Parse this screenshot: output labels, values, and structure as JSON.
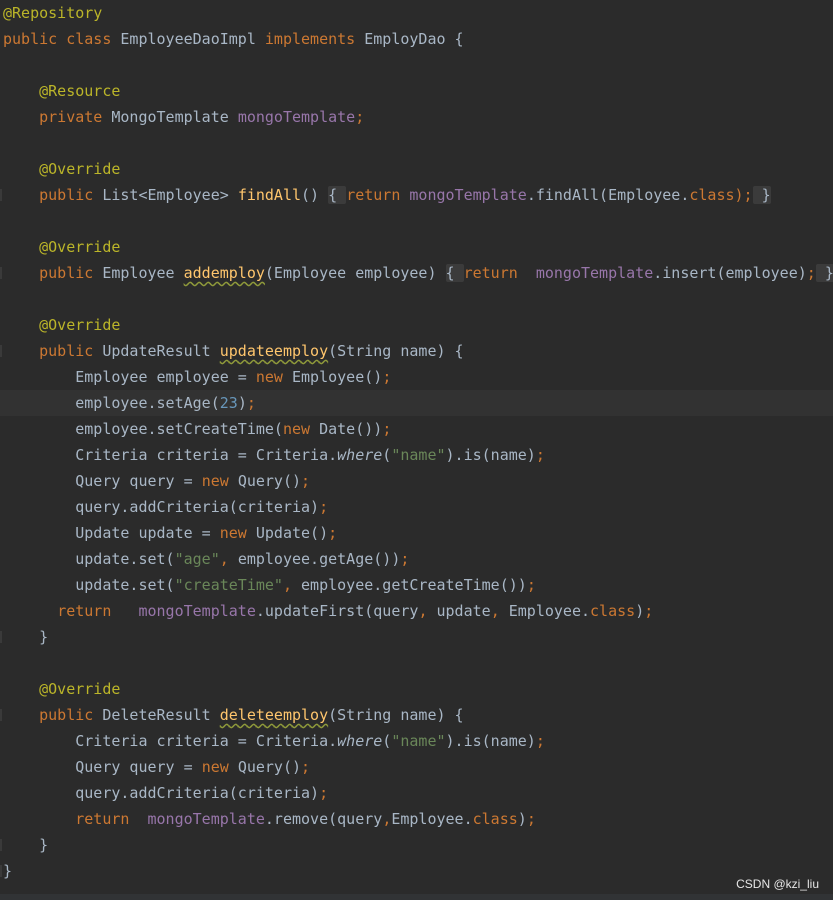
{
  "code": {
    "lines": [
      {
        "tokens": [
          {
            "t": "@Repository",
            "c": "ann"
          }
        ]
      },
      {
        "tokens": [
          {
            "t": "public ",
            "c": "kw"
          },
          {
            "t": "class ",
            "c": "kw"
          },
          {
            "t": "EmployeeDaoImpl ",
            "c": "cls"
          },
          {
            "t": "implements ",
            "c": "kw"
          },
          {
            "t": "EmployDao {",
            "c": "cls"
          }
        ]
      },
      {
        "tokens": []
      },
      {
        "tokens": [
          {
            "t": "    "
          },
          {
            "t": "@Resource",
            "c": "ann"
          }
        ]
      },
      {
        "tokens": [
          {
            "t": "    "
          },
          {
            "t": "private ",
            "c": "kw"
          },
          {
            "t": "MongoTemplate ",
            "c": "cls"
          },
          {
            "t": "mongoTemplate",
            "c": "field"
          },
          {
            "t": ";",
            "c": "kw"
          }
        ]
      },
      {
        "tokens": []
      },
      {
        "tokens": [
          {
            "t": "    "
          },
          {
            "t": "@Override",
            "c": "ann"
          }
        ]
      },
      {
        "gutter": true,
        "tokens": [
          {
            "t": "    "
          },
          {
            "t": "public ",
            "c": "kw"
          },
          {
            "t": "List<Employee> ",
            "c": "cls"
          },
          {
            "t": "findAll",
            "c": "method"
          },
          {
            "t": "() "
          },
          {
            "t": "{ ",
            "c": "fold"
          },
          {
            "t": "return ",
            "c": "kw"
          },
          {
            "t": "mongoTemplate",
            "c": "field"
          },
          {
            "t": ".findAll(Employee."
          },
          {
            "t": "class",
            "c": "kw"
          },
          {
            "t": ");",
            "c": "kw"
          },
          {
            "t": " }",
            "c": "fold"
          }
        ]
      },
      {
        "tokens": []
      },
      {
        "tokens": [
          {
            "t": "    "
          },
          {
            "t": "@Override",
            "c": "ann"
          }
        ]
      },
      {
        "gutter": true,
        "tokens": [
          {
            "t": "    "
          },
          {
            "t": "public ",
            "c": "kw"
          },
          {
            "t": "Employee ",
            "c": "cls"
          },
          {
            "t": "addemploy",
            "c": "method warn"
          },
          {
            "t": "(Employee employee) "
          },
          {
            "t": "{ ",
            "c": "fold"
          },
          {
            "t": "return  ",
            "c": "kw"
          },
          {
            "t": "mongoTemplate",
            "c": "field"
          },
          {
            "t": ".insert(employee)"
          },
          {
            "t": ";",
            "c": "kw"
          },
          {
            "t": " }",
            "c": "fold"
          }
        ]
      },
      {
        "tokens": []
      },
      {
        "tokens": [
          {
            "t": "    "
          },
          {
            "t": "@Override",
            "c": "ann"
          }
        ]
      },
      {
        "gutter": true,
        "tokens": [
          {
            "t": "    "
          },
          {
            "t": "public ",
            "c": "kw"
          },
          {
            "t": "UpdateResult ",
            "c": "cls"
          },
          {
            "t": "updateemploy",
            "c": "method warn"
          },
          {
            "t": "(String name) {"
          }
        ]
      },
      {
        "tokens": [
          {
            "t": "        Employee employee = "
          },
          {
            "t": "new ",
            "c": "kw"
          },
          {
            "t": "Employee()"
          },
          {
            "t": ";",
            "c": "kw"
          }
        ]
      },
      {
        "current": true,
        "tokens": [
          {
            "t": "        employee.setAge("
          },
          {
            "t": "23",
            "c": "num"
          },
          {
            "t": ")"
          },
          {
            "t": ";",
            "c": "kw"
          }
        ]
      },
      {
        "tokens": [
          {
            "t": "        employee.setCreateTime("
          },
          {
            "t": "new ",
            "c": "kw"
          },
          {
            "t": "Date())"
          },
          {
            "t": ";",
            "c": "kw"
          }
        ]
      },
      {
        "tokens": [
          {
            "t": "        Criteria criteria = Criteria."
          },
          {
            "t": "where",
            "c": "italic"
          },
          {
            "t": "("
          },
          {
            "t": "\"name\"",
            "c": "str"
          },
          {
            "t": ").is(name)"
          },
          {
            "t": ";",
            "c": "kw"
          }
        ]
      },
      {
        "tokens": [
          {
            "t": "        Query query = "
          },
          {
            "t": "new ",
            "c": "kw"
          },
          {
            "t": "Query()"
          },
          {
            "t": ";",
            "c": "kw"
          }
        ]
      },
      {
        "tokens": [
          {
            "t": "        query.addCriteria(criteria)"
          },
          {
            "t": ";",
            "c": "kw"
          }
        ]
      },
      {
        "tokens": [
          {
            "t": "        Update update = "
          },
          {
            "t": "new ",
            "c": "kw"
          },
          {
            "t": "Update()"
          },
          {
            "t": ";",
            "c": "kw"
          }
        ]
      },
      {
        "tokens": [
          {
            "t": "        update.set("
          },
          {
            "t": "\"age\"",
            "c": "str"
          },
          {
            "t": ", ",
            "c": "kw"
          },
          {
            "t": "employee.getAge())"
          },
          {
            "t": ";",
            "c": "kw"
          }
        ]
      },
      {
        "tokens": [
          {
            "t": "        update.set("
          },
          {
            "t": "\"createTime\"",
            "c": "str"
          },
          {
            "t": ", ",
            "c": "kw"
          },
          {
            "t": "employee.getCreateTime())"
          },
          {
            "t": ";",
            "c": "kw"
          }
        ]
      },
      {
        "tokens": [
          {
            "t": "      "
          },
          {
            "t": "return   ",
            "c": "kw"
          },
          {
            "t": "mongoTemplate",
            "c": "field"
          },
          {
            "t": ".updateFirst(query"
          },
          {
            "t": ", ",
            "c": "kw"
          },
          {
            "t": "update"
          },
          {
            "t": ", ",
            "c": "kw"
          },
          {
            "t": "Employee."
          },
          {
            "t": "class",
            "c": "kw"
          },
          {
            "t": ")"
          },
          {
            "t": ";",
            "c": "kw"
          }
        ]
      },
      {
        "gutter": true,
        "tokens": [
          {
            "t": "    }"
          }
        ]
      },
      {
        "tokens": []
      },
      {
        "tokens": [
          {
            "t": "    "
          },
          {
            "t": "@Override",
            "c": "ann"
          }
        ]
      },
      {
        "gutter": true,
        "tokens": [
          {
            "t": "    "
          },
          {
            "t": "public ",
            "c": "kw"
          },
          {
            "t": "DeleteResult ",
            "c": "cls"
          },
          {
            "t": "deleteemploy",
            "c": "method warn"
          },
          {
            "t": "(String name) {"
          }
        ]
      },
      {
        "tokens": [
          {
            "t": "        Criteria criteria = Criteria."
          },
          {
            "t": "where",
            "c": "italic"
          },
          {
            "t": "("
          },
          {
            "t": "\"name\"",
            "c": "str"
          },
          {
            "t": ").is(name)"
          },
          {
            "t": ";",
            "c": "kw"
          }
        ]
      },
      {
        "tokens": [
          {
            "t": "        Query query = "
          },
          {
            "t": "new ",
            "c": "kw"
          },
          {
            "t": "Query()"
          },
          {
            "t": ";",
            "c": "kw"
          }
        ]
      },
      {
        "tokens": [
          {
            "t": "        query.addCriteria(criteria)"
          },
          {
            "t": ";",
            "c": "kw"
          }
        ]
      },
      {
        "tokens": [
          {
            "t": "        "
          },
          {
            "t": "return  ",
            "c": "kw"
          },
          {
            "t": "mongoTemplate",
            "c": "field"
          },
          {
            "t": ".remove(query"
          },
          {
            "t": ",",
            "c": "kw"
          },
          {
            "t": "Employee."
          },
          {
            "t": "class",
            "c": "kw"
          },
          {
            "t": ")"
          },
          {
            "t": ";",
            "c": "kw"
          }
        ]
      },
      {
        "gutter": true,
        "tokens": [
          {
            "t": "    }"
          }
        ]
      },
      {
        "gutter": true,
        "tokens": [
          {
            "t": "}"
          }
        ]
      }
    ]
  },
  "watermark": "CSDN @kzi_liu",
  "colors": {
    "background": "#2b2b2b",
    "keyword": "#cc7832",
    "annotation": "#bbb529",
    "field": "#9876aa",
    "method": "#ffc66d",
    "string": "#6a8759",
    "number": "#6897bb",
    "text": "#a9b7c6"
  }
}
